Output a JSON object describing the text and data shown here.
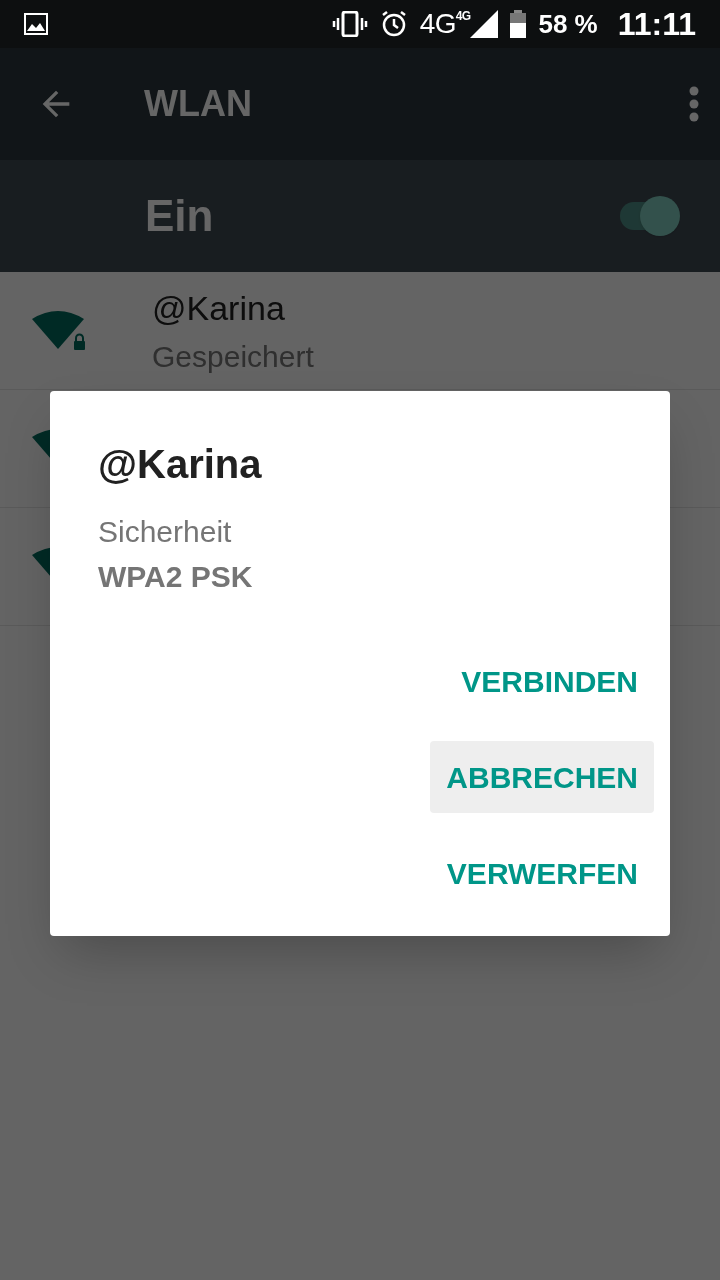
{
  "status_bar": {
    "network": "4G",
    "network_small": "4G",
    "battery": "58 %",
    "time": "11:11"
  },
  "toolbar": {
    "title": "WLAN"
  },
  "master_switch": {
    "label": "Ein",
    "on": true
  },
  "networks": [
    {
      "kind": "named",
      "name": "@Karina",
      "status": "Gespeichert",
      "locked": true
    },
    {
      "kind": "covered"
    },
    {
      "kind": "covered"
    }
  ],
  "dialog": {
    "title": "@Karina",
    "field_label": "Sicherheit",
    "field_value": "WPA2 PSK",
    "buttons": [
      {
        "label": "VERBINDEN",
        "selected": false
      },
      {
        "label": "ABBRECHEN",
        "selected": true
      },
      {
        "label": "VERWERFEN",
        "selected": false
      }
    ]
  }
}
